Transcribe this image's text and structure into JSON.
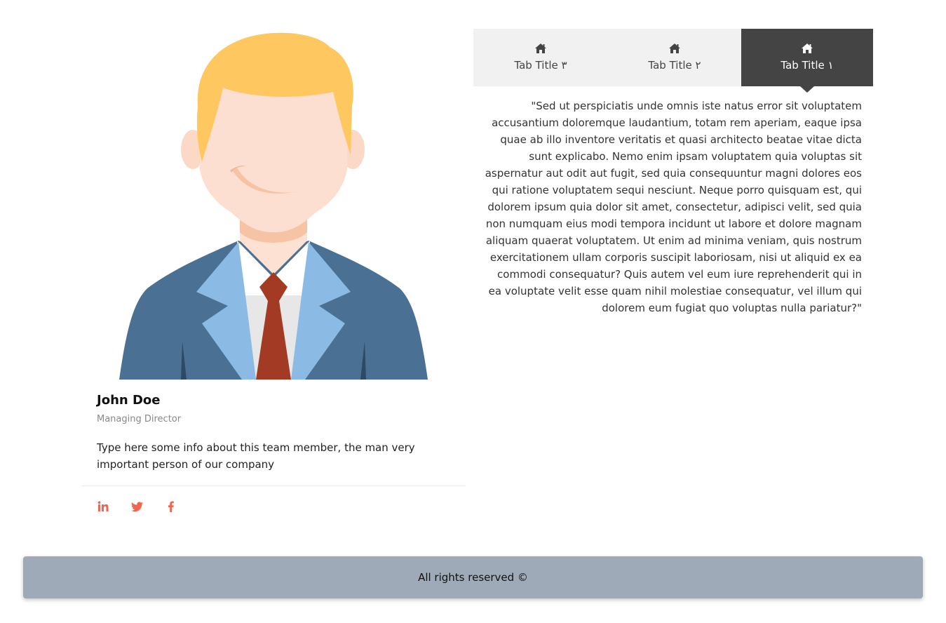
{
  "team_member": {
    "name": "John Doe",
    "role": "Managing Director",
    "info": "Type here some info about this team member, the man very important person of our company",
    "avatar_icon": "businessman-avatar",
    "social": [
      {
        "icon": "linkedin-icon",
        "color": "#f06552"
      },
      {
        "icon": "twitter-icon",
        "color": "#f06552"
      },
      {
        "icon": "facebook-icon",
        "color": "#f06552"
      }
    ]
  },
  "tabs": {
    "items": [
      {
        "label": "Tab Title ۳",
        "icon": "home-icon",
        "active": false
      },
      {
        "label": "Tab Title ۲",
        "icon": "home-icon",
        "active": false
      },
      {
        "label": "Tab Title ۱",
        "icon": "home-icon",
        "active": true
      }
    ],
    "content": "\"Sed ut perspiciatis unde omnis iste natus error sit voluptatem accusantium doloremque laudantium, totam rem aperiam, eaque ipsa quae ab illo inventore veritatis et quasi architecto beatae vitae dicta sunt explicabo. Nemo enim ipsam voluptatem quia voluptas sit aspernatur aut odit aut fugit, sed quia consequuntur magni dolores eos qui ratione voluptatem sequi nesciunt. Neque porro quisquam est, qui dolorem ipsum quia dolor sit amet, consectetur, adipisci velit, sed quia non numquam eius modi tempora incidunt ut labore et dolore magnam aliquam quaerat voluptatem. Ut enim ad minima veniam, quis nostrum exercitationem ullam corporis suscipit laboriosam, nisi ut aliquid ex ea commodi consequatur? Quis autem vel eum iure reprehenderit qui in ea voluptate velit esse quam nihil molestiae consequatur, vel illum qui dolorem eum fugiat quo voluptas nulla pariatur?\"",
    "active_color": "#444444",
    "inactive_bg": "#f1f1f1"
  },
  "footer": {
    "text": "All rights reserved ©",
    "bg_color": "#9eaab7"
  }
}
